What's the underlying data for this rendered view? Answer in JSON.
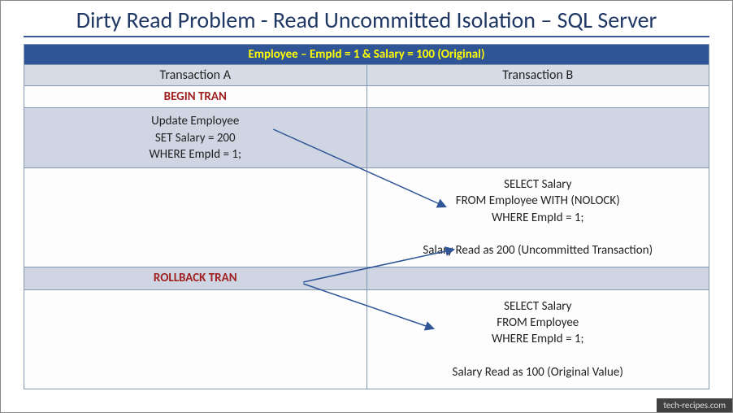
{
  "title": "Dirty Read Problem - Read Uncommitted Isolation – SQL Server",
  "banner": "Employee – EmpId = 1 & Salary = 100 (Original)",
  "columns": {
    "a": "Transaction A",
    "b": "Transaction B"
  },
  "rows": {
    "r1": {
      "a": "BEGIN TRAN",
      "b": ""
    },
    "r2": {
      "a": "Update Employee\nSET Salary = 200\nWHERE EmpId = 1;",
      "b": ""
    },
    "r3": {
      "a": "",
      "b": "SELECT Salary\nFROM Employee WITH (NOLOCK)\nWHERE EmpId = 1;\n\nSalary Read as 200 (Uncommitted Transaction)"
    },
    "r4": {
      "a": "ROLLBACK TRAN",
      "b": ""
    },
    "r5": {
      "a": "",
      "b": "SELECT Salary\nFROM Employee\nWHERE EmpId = 1;\n\nSalary Read as 100 (Original Value)"
    }
  },
  "footer": "tech-recipes.com"
}
